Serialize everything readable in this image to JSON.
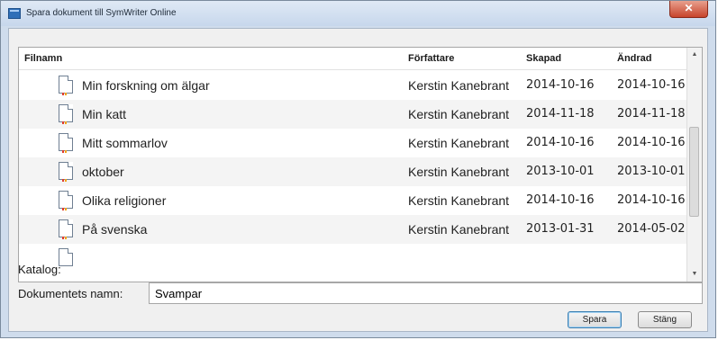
{
  "window": {
    "title": "Spara dokument till SymWriter Online",
    "close_icon": "close-icon"
  },
  "table": {
    "headers": {
      "name": "Filnamn",
      "author": "Författare",
      "created": "Skapad",
      "modified": "Ändrad"
    },
    "rows": [
      {
        "name": "Min forskning om älgar",
        "author": "Kerstin Kanebrant",
        "created": "2014-10-16",
        "modified": "2014-10-16"
      },
      {
        "name": "Min katt",
        "author": "Kerstin Kanebrant",
        "created": "2014-11-18",
        "modified": "2014-11-18"
      },
      {
        "name": "Mitt sommarlov",
        "author": "Kerstin Kanebrant",
        "created": "2014-10-16",
        "modified": "2014-10-16"
      },
      {
        "name": "oktober",
        "author": "Kerstin Kanebrant",
        "created": "2013-10-01",
        "modified": "2013-10-01"
      },
      {
        "name": "Olika religioner",
        "author": "Kerstin Kanebrant",
        "created": "2014-10-16",
        "modified": "2014-10-16"
      },
      {
        "name": "På svenska",
        "author": "Kerstin Kanebrant",
        "created": "2013-01-31",
        "modified": "2014-05-02"
      },
      {
        "name": "",
        "author": "",
        "created": "",
        "modified": ""
      }
    ],
    "row_icon": "document-icon"
  },
  "form": {
    "catalog_label": "Katalog:",
    "docname_label": "Dokumentets namn:",
    "docname_value": "Svampar"
  },
  "buttons": {
    "save": "Spara",
    "close": "Stäng"
  }
}
